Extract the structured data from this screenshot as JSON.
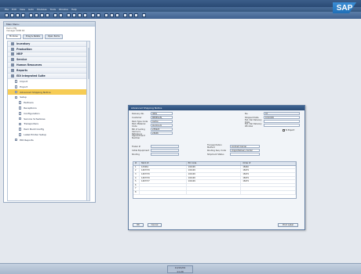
{
  "menubar": {
    "items": [
      "File",
      "Edit",
      "View",
      "Goto",
      "Modules",
      "Tools",
      "Window",
      "Help"
    ]
  },
  "brand": {
    "logo_text": "SAP"
  },
  "main_menu": {
    "title": "Main Menu",
    "info_line1": "Demo Mfg",
    "info_line2": "manager 2008 R2",
    "tabs": [
      "Modules",
      "Drag & Relate",
      "Open Items"
    ],
    "items": [
      {
        "label": "Inventory",
        "level": 0
      },
      {
        "label": "Production",
        "level": 0
      },
      {
        "label": "MRP",
        "level": 0
      },
      {
        "label": "Service",
        "level": 0
      },
      {
        "label": "Human Resources",
        "level": 0
      },
      {
        "label": "Reports",
        "level": 0
      },
      {
        "label": "EDI Integrated Suite",
        "level": 0
      },
      {
        "label": "Import",
        "level": 1
      },
      {
        "label": "Export",
        "level": 1
      },
      {
        "label": "Advanced Shipping Notice",
        "level": 1,
        "selected": true
      },
      {
        "label": "Setup",
        "level": 1
      },
      {
        "label": "Partners",
        "level": 2
      },
      {
        "label": "Receptions",
        "level": 2
      },
      {
        "label": "Configuration",
        "level": 2
      },
      {
        "label": "Service Schedules",
        "level": 2
      },
      {
        "label": "Transporters",
        "level": 2
      },
      {
        "label": "Item Build Config",
        "level": 2
      },
      {
        "label": "Label Printer Setup",
        "level": 2
      },
      {
        "label": "EDI Reports",
        "level": 1
      }
    ]
  },
  "dialog": {
    "title": "Advanced Shipping Notice",
    "left_fields": [
      {
        "label": "Delivery No.",
        "value": "3081"
      },
      {
        "label": "Customer",
        "value": "MEDELLIN_"
      },
      {
        "label": "Pack Type Code",
        "value": "Carton"
      },
      {
        "label": "Pack Material Code",
        "value": "Aluminum"
      },
      {
        "label": "Bill of Lading",
        "value": "235623"
      },
      {
        "label": "Carrier's Reference",
        "value": "23638"
      },
      {
        "label": "Appointment Number",
        "value": ""
      }
    ],
    "right_fields": [
      {
        "label": "No.",
        "value": "37"
      },
      {
        "label": "Shipped Date",
        "value": "10/22/09"
      },
      {
        "label": "Est. Del Delivery Date",
        "value": ""
      },
      {
        "label": "Est. Del Delivery Window",
        "value": ""
      }
    ],
    "checkbox_label": "To Export",
    "mid_left": [
      {
        "label": "Trailer #",
        "value": ""
      },
      {
        "label": "Initial Equipment",
        "value": ""
      },
      {
        "label": "Routing",
        "value": ""
      }
    ],
    "mid_right": [
      {
        "label": "Transportation Method",
        "value": "Contract Carrier"
      },
      {
        "label": "Routing Seq. Code",
        "value": "Origin/Delivery Carrier"
      },
      {
        "label": "Shipment Status",
        "value": ""
      }
    ],
    "grid": {
      "headers": [
        "#",
        "SSCC #",
        "PO Code",
        "Order #"
      ],
      "rows": [
        [
          "1",
          "123461",
          "102109",
          "18240"
        ],
        [
          "2",
          "1467379",
          "102109",
          "18479"
        ],
        [
          "3",
          "1467379",
          "102109",
          "18479"
        ],
        [
          "4",
          "1467379",
          "102109",
          "18479"
        ],
        [
          "5",
          "1467377",
          "102109",
          "18479"
        ],
        [
          "6",
          "",
          "",
          ""
        ],
        [
          "7",
          "",
          "",
          ""
        ],
        [
          "8",
          "",
          "",
          ""
        ]
      ]
    },
    "ok_button": "OK",
    "cancel_button": "Cancel",
    "print_button": "Print Label"
  },
  "status": {
    "date": "10/22/09",
    "time": "11:20"
  }
}
